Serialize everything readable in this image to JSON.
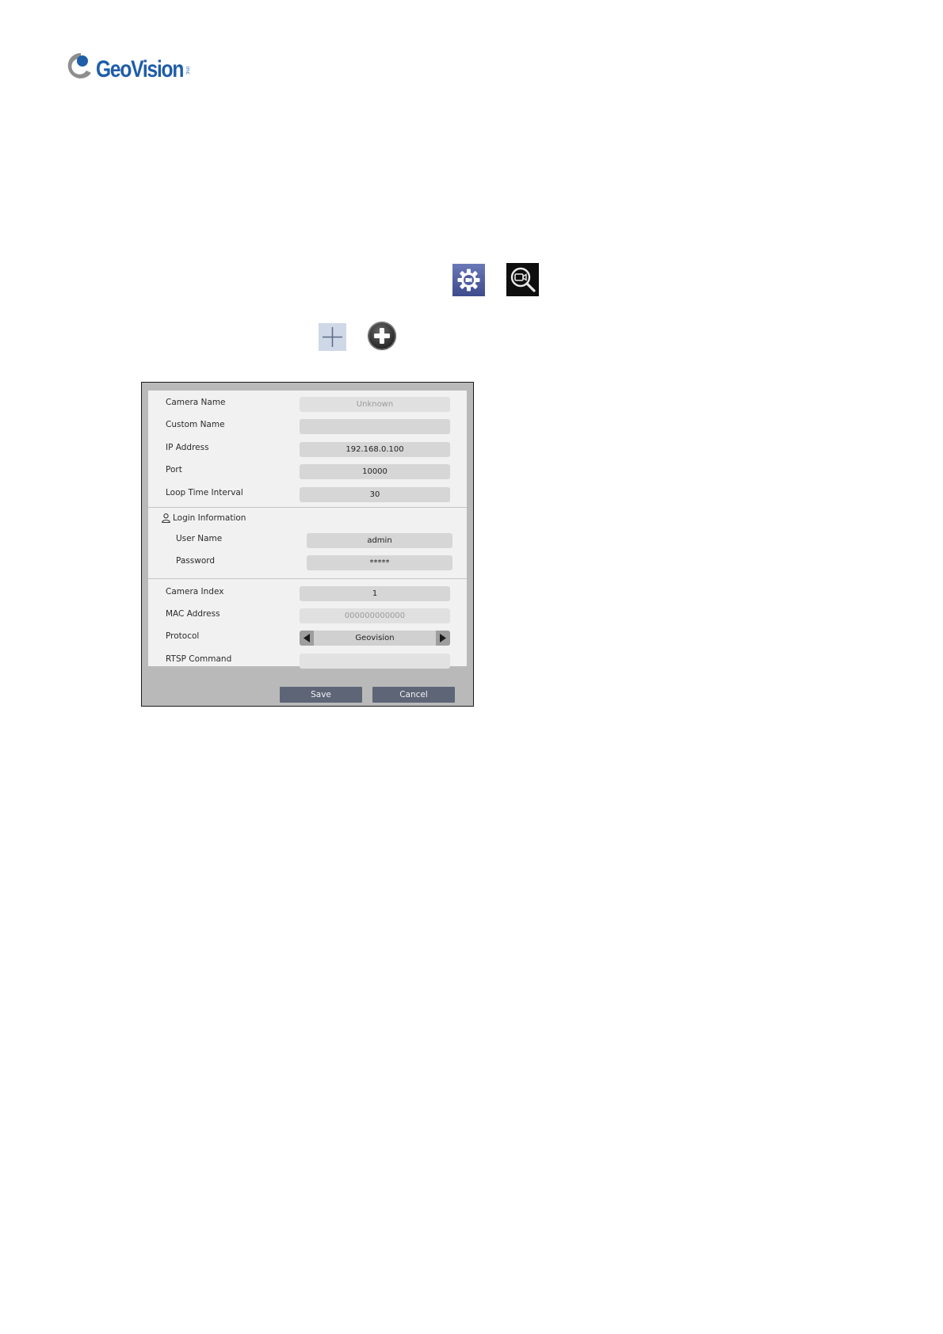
{
  "logo": {
    "brand": "GeoVision",
    "suffix": "inc"
  },
  "icons": {
    "settings": "settings-gear-icon",
    "camera_search": "camera-search-icon",
    "plus": "plus-icon",
    "plus_circle": "plus-circle-icon"
  },
  "dialog": {
    "fields": [
      {
        "label": "Camera Name",
        "value": "Unknown"
      },
      {
        "label": "Custom Name",
        "value": ""
      },
      {
        "label": "IP Address",
        "value": "192.168.0.100"
      },
      {
        "label": "Port",
        "value": "10000"
      },
      {
        "label": "Loop Time Interval",
        "value": "30"
      }
    ],
    "login": {
      "heading": "Login Information",
      "fields": [
        {
          "label": "User Name",
          "value": "admin"
        },
        {
          "label": "Password",
          "value": "*****"
        }
      ]
    },
    "advanced": [
      {
        "label": "Camera Index",
        "value": "1"
      },
      {
        "label": "MAC Address",
        "value": "000000000000"
      },
      {
        "label": "Protocol",
        "value": "Geovision"
      },
      {
        "label": "RTSP Command",
        "value": ""
      }
    ],
    "buttons": {
      "save": "Save",
      "cancel": "Cancel"
    }
  },
  "colors": {
    "brand_blue": "#1f5da8",
    "button": "#5d6577",
    "dialog_frame": "#b9b9b9",
    "dialog_panel": "#f1f1f1",
    "field": "#d6d6d6"
  }
}
